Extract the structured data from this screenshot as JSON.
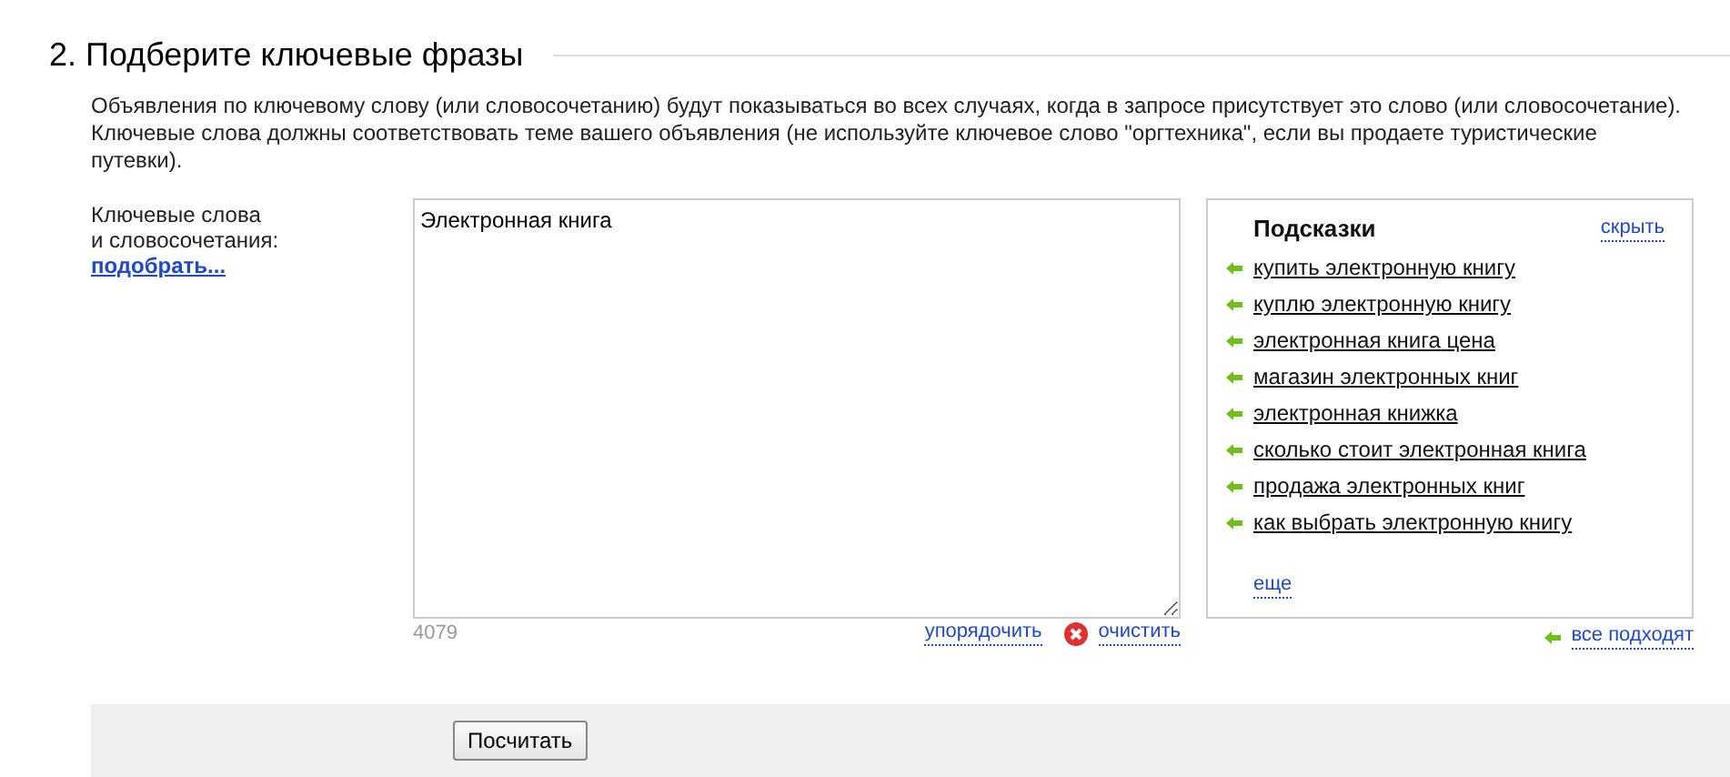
{
  "section": {
    "title": "2. Подберите ключевые фразы",
    "description": "Объявления по ключевому слову (или словосочетанию) будут показываться во всех случаях, когда в запросе присутствует это слово (или словосочетание). Ключевые слова должны соответствовать теме вашего объявления (не используйте ключевое слово \"оргтехника\", если вы продаете туристические путевки)."
  },
  "keywords": {
    "label_lines": [
      "Ключевые слова",
      "и словосочетания:"
    ],
    "pick_link": "подобрать...",
    "value": "Электронная книга",
    "counter": "4079",
    "sort_link": "упорядочить",
    "clear_link": "очистить"
  },
  "suggestions": {
    "title": "Подсказки",
    "hide_link": "скрыть",
    "items": [
      "купить электронную книгу",
      "куплю электронную книгу",
      "электронная книга цена",
      "магазин электронных книг",
      "электронная книжка",
      "сколько стоит электронная книга",
      "продажа электронных книг",
      "как выбрать электронную книгу"
    ],
    "more_link": "еще",
    "all_link": "все подходят"
  },
  "buttons": [
    "Посчитать"
  ]
}
